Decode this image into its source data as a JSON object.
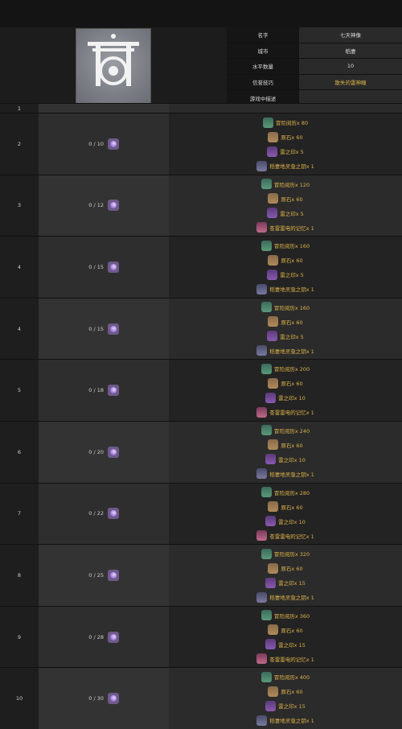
{
  "info": [
    {
      "label": "名字",
      "value": "七天神像",
      "gold": false
    },
    {
      "label": "城市",
      "value": "稻妻",
      "gold": false
    },
    {
      "label": "水平数量",
      "value": "10",
      "gold": false
    },
    {
      "label": "信誉技巧",
      "value": "散失的雷神瞳",
      "gold": true
    },
    {
      "label": "游戏中描述",
      "value": "",
      "gold": false
    }
  ],
  "first_row_level": "1",
  "rows": [
    {
      "level": "2",
      "progress": "0 / 10",
      "mats": [
        {
          "icon": "exp",
          "text": "冒险阅历x 80"
        },
        {
          "icon": "ore",
          "text": "原石x 60"
        },
        {
          "icon": "mark",
          "text": "雷之印x 5"
        },
        {
          "icon": "spec",
          "text": "稻妻地灵龛之钥x 1"
        }
      ]
    },
    {
      "level": "3",
      "progress": "0 / 12",
      "mats": [
        {
          "icon": "exp",
          "text": "冒险阅历x 120"
        },
        {
          "icon": "ore",
          "text": "原石x 60"
        },
        {
          "icon": "mark",
          "text": "雷之印x 5"
        },
        {
          "icon": "mem",
          "text": "苍雷雷电的记忆x 1"
        }
      ]
    },
    {
      "level": "4",
      "progress": "0 / 15",
      "mats": [
        {
          "icon": "exp",
          "text": "冒险阅历x 160"
        },
        {
          "icon": "ore",
          "text": "原石x 60"
        },
        {
          "icon": "mark",
          "text": "雷之印x 5"
        },
        {
          "icon": "spec",
          "text": "稻妻地灵龛之钥x 1"
        }
      ]
    },
    {
      "level": "4",
      "progress": "0 / 15",
      "mats": [
        {
          "icon": "exp",
          "text": "冒险阅历x 160"
        },
        {
          "icon": "ore",
          "text": "原石x 60"
        },
        {
          "icon": "mark",
          "text": "雷之印x 5"
        },
        {
          "icon": "spec",
          "text": "稻妻地灵龛之钥x 1"
        }
      ]
    },
    {
      "level": "5",
      "progress": "0 / 18",
      "mats": [
        {
          "icon": "exp",
          "text": "冒险阅历x 200"
        },
        {
          "icon": "ore",
          "text": "原石x 60"
        },
        {
          "icon": "mark",
          "text": "雷之印x 10"
        },
        {
          "icon": "mem",
          "text": "苍雷雷电的记忆x 1"
        }
      ]
    },
    {
      "level": "6",
      "progress": "0 / 20",
      "mats": [
        {
          "icon": "exp",
          "text": "冒险阅历x 240"
        },
        {
          "icon": "ore",
          "text": "原石x 60"
        },
        {
          "icon": "mark",
          "text": "雷之印x 10"
        },
        {
          "icon": "spec",
          "text": "稻妻地灵龛之钥x 1"
        }
      ]
    },
    {
      "level": "7",
      "progress": "0 / 22",
      "mats": [
        {
          "icon": "exp",
          "text": "冒险阅历x 280"
        },
        {
          "icon": "ore",
          "text": "原石x 60"
        },
        {
          "icon": "mark",
          "text": "雷之印x 10"
        },
        {
          "icon": "mem",
          "text": "苍雷雷电的记忆x 1"
        }
      ]
    },
    {
      "level": "8",
      "progress": "0 / 25",
      "mats": [
        {
          "icon": "exp",
          "text": "冒险阅历x 320"
        },
        {
          "icon": "ore",
          "text": "原石x 60"
        },
        {
          "icon": "mark",
          "text": "雷之印x 15"
        },
        {
          "icon": "spec",
          "text": "稻妻地灵龛之钥x 1"
        }
      ]
    },
    {
      "level": "9",
      "progress": "0 / 28",
      "mats": [
        {
          "icon": "exp",
          "text": "冒险阅历x 360"
        },
        {
          "icon": "ore",
          "text": "原石x 60"
        },
        {
          "icon": "mark",
          "text": "雷之印x 15"
        },
        {
          "icon": "mem",
          "text": "苍雷雷电的记忆x 1"
        }
      ]
    },
    {
      "level": "10",
      "progress": "0 / 30",
      "mats": [
        {
          "icon": "exp",
          "text": "冒险阅历x 400"
        },
        {
          "icon": "ore",
          "text": "原石x 60"
        },
        {
          "icon": "mark",
          "text": "雷之印x 15"
        },
        {
          "icon": "spec",
          "text": "稻妻地灵龛之钥x 1"
        }
      ]
    }
  ]
}
